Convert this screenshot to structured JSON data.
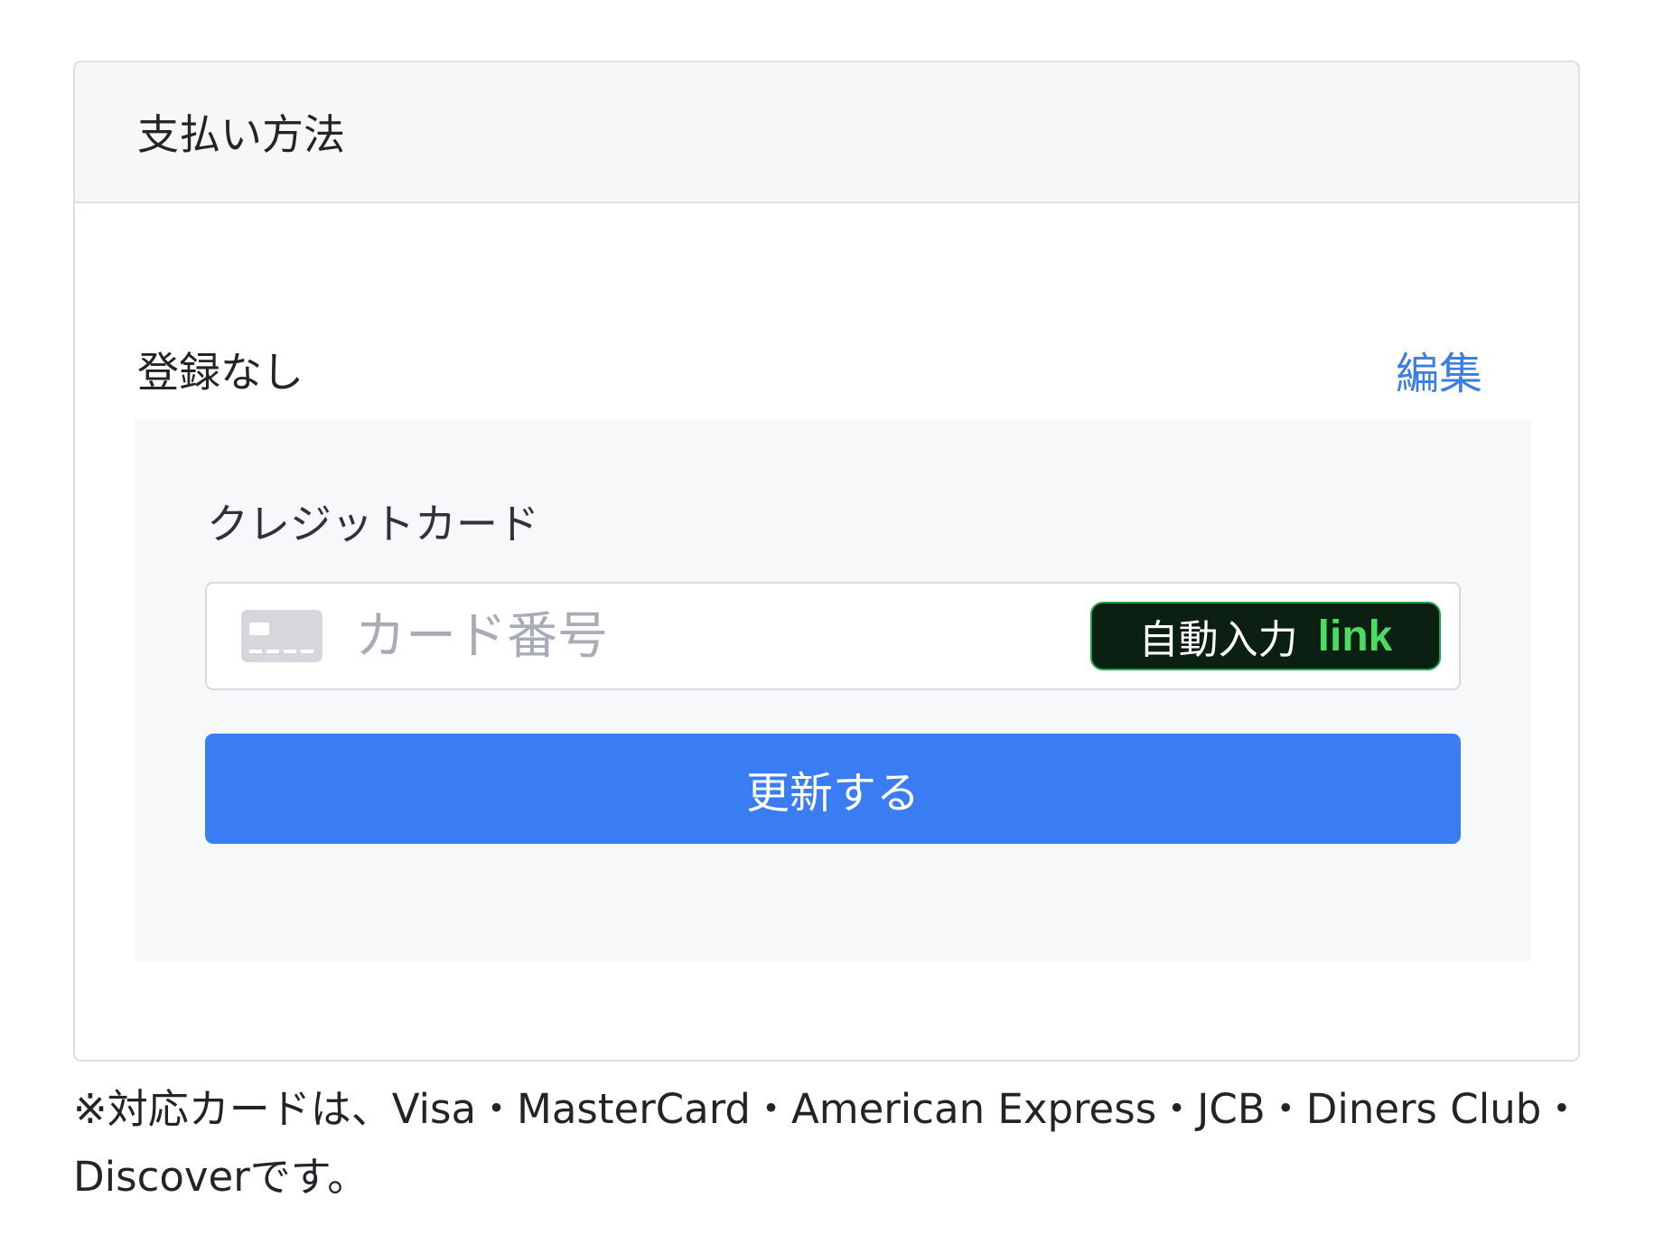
{
  "card": {
    "title": "支払い方法"
  },
  "status": {
    "text": "登録なし",
    "edit_label": "編集"
  },
  "payment_form": {
    "field_label": "クレジットカード",
    "card_number_placeholder": "カード番号",
    "card_number_value": "",
    "autofill_label": "自動入力",
    "autofill_brand": "link",
    "update_button_label": "更新する"
  },
  "footnote": "※対応カードは、Visa・MasterCard・American Express・JCB・Diners Club・Discoverです。",
  "colors": {
    "accent": "#3a7cf1",
    "link_text": "#3a7de3",
    "link_brand_green": "#4cd964",
    "autofill_bg": "#0b1f12"
  },
  "icons": {
    "card_brand": "credit-card-icon"
  }
}
